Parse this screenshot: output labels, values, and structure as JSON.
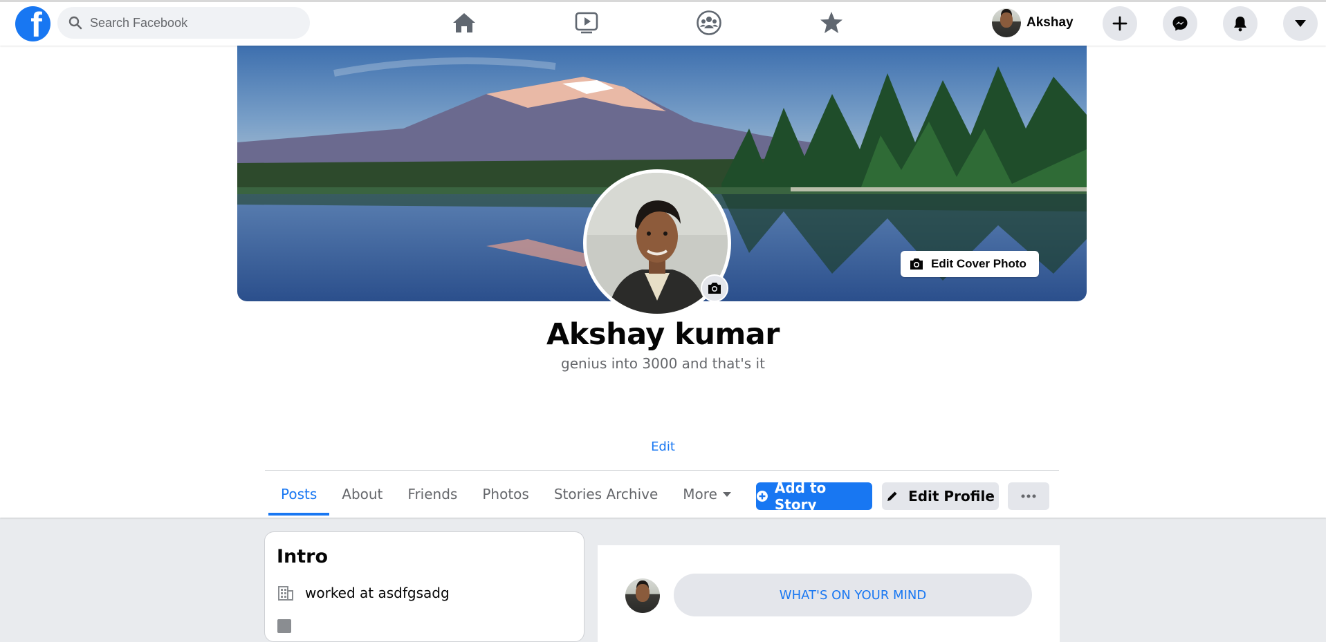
{
  "topbar": {
    "logo_letter": "f",
    "search_placeholder": "Search Facebook",
    "nav_icons": [
      "home-icon",
      "watch-icon",
      "groups-icon",
      "favorites-icon"
    ],
    "user_name": "Akshay",
    "action_icons": [
      "plus-icon",
      "messenger-icon",
      "notifications-icon",
      "account-menu-icon"
    ],
    "colors": {
      "brand": "#1877f2",
      "icon_gray": "#606770"
    }
  },
  "profile": {
    "edit_cover_label": "Edit Cover Photo",
    "name": "Akshay kumar",
    "bio": "genius into 3000 and that's it",
    "edit_bio_label": "Edit"
  },
  "tabs": [
    {
      "label": "Posts",
      "active": true
    },
    {
      "label": "About"
    },
    {
      "label": "Friends"
    },
    {
      "label": "Photos"
    },
    {
      "label": "Stories Archive"
    },
    {
      "label": "More"
    }
  ],
  "actions": {
    "add_story_label": "Add to Story",
    "edit_profile_label": "Edit Profile",
    "more_label": "···"
  },
  "intro": {
    "title": "Intro",
    "work": "worked at asdfgsadg"
  },
  "composer": {
    "prompt": "WHAT'S ON YOUR MIND"
  }
}
